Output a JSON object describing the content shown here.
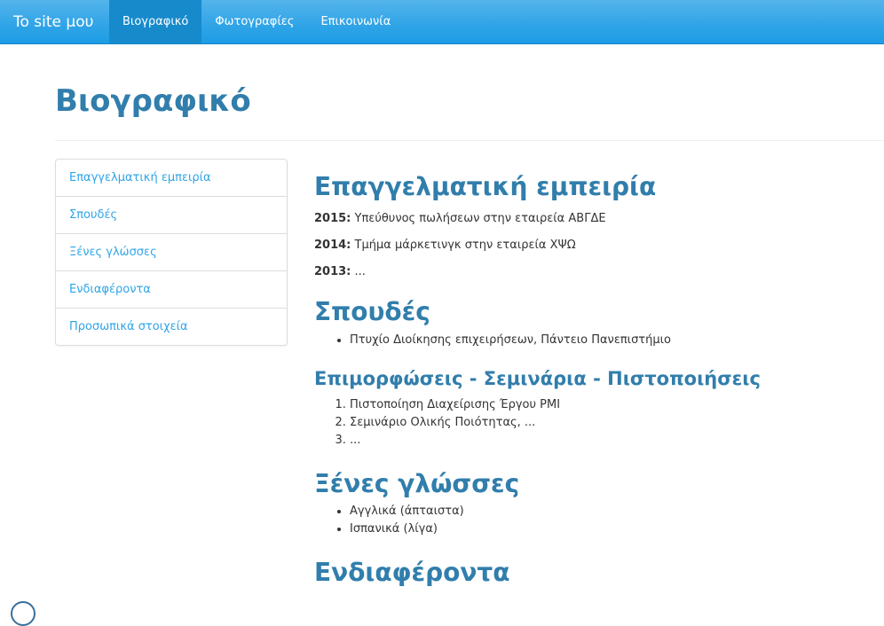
{
  "navbar": {
    "brand": "To site μου",
    "items": [
      {
        "label": "Βιογραφικό",
        "active": true
      },
      {
        "label": "Φωτογραφίες",
        "active": false
      },
      {
        "label": "Επικοινωνία",
        "active": false
      }
    ]
  },
  "page": {
    "title": "Βιογραφικό"
  },
  "sidebar": {
    "items": [
      {
        "label": "Επαγγελματική εμπειρία"
      },
      {
        "label": "Σπουδές"
      },
      {
        "label": "Ξένες γλώσσες"
      },
      {
        "label": "Ενδιαφέροντα"
      },
      {
        "label": "Προσωπικά στοιχεία"
      }
    ]
  },
  "experience": {
    "heading": "Επαγγελματική εμπειρία",
    "entries": [
      {
        "year": "2015:",
        "text": " Υπεύθυνος πωλήσεων στην εταιρεία ΑΒΓΔΕ"
      },
      {
        "year": "2014:",
        "text": " Τμήμα μάρκετινγκ στην εταιρεία ΧΨΩ"
      },
      {
        "year": "2013:",
        "text": " ..."
      }
    ]
  },
  "studies": {
    "heading": "Σπουδές",
    "items": [
      "Πτυχίο Διοίκησης επιχειρήσεων, Πάντειο Πανεπιστήμιο"
    ]
  },
  "seminars": {
    "heading": "Επιμορφώσεις - Σεμινάρια - Πιστοποιήσεις",
    "items": [
      "Πιστοποίηση Διαχείρισης Έργου PMI",
      "Σεμινάριο Ολικής Ποιότητας, ...",
      "..."
    ]
  },
  "languages": {
    "heading": "Ξένες γλώσσες",
    "items": [
      "Αγγλικά (άπταιστα)",
      "Ισπανικά (λίγα)"
    ]
  },
  "interests": {
    "heading": "Ενδιαφέροντα"
  },
  "colors": {
    "navbar": "#2fa4e7",
    "navbar_active": "#178acc",
    "heading": "#317eac",
    "link": "#2fa4e7"
  }
}
